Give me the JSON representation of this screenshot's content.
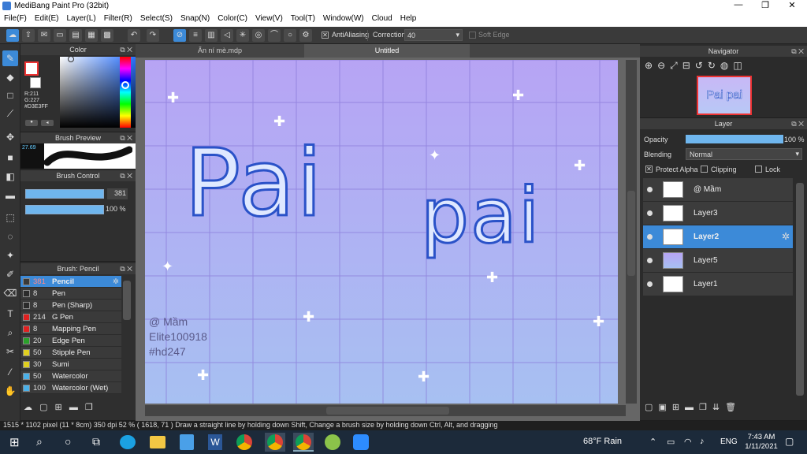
{
  "app": {
    "title": "MediBang Paint Pro (32bit)",
    "min": "—",
    "max": "❐",
    "close": "✕"
  },
  "menu": [
    "File(F)",
    "Edit(E)",
    "Layer(L)",
    "Filter(R)",
    "Select(S)",
    "Snap(N)",
    "Color(C)",
    "View(V)",
    "Tool(T)",
    "Window(W)",
    "Cloud",
    "Help"
  ],
  "toolbar": {
    "antialias": "AntiAliasing",
    "correction_label": "Correction",
    "correction_value": "40",
    "soft_edge": "Soft Edge"
  },
  "color_panel": {
    "title": "Color",
    "r": "R:211",
    "g": "G:227",
    "hex": "#D3E3FF",
    "accent": "#D3E3FF"
  },
  "brush_preview": {
    "title": "Brush Preview",
    "size": "27.69"
  },
  "brush_control": {
    "title": "Brush Control",
    "size": "381",
    "opacity": "100 %"
  },
  "brush_list": {
    "title": "Brush: Pencil",
    "items": [
      {
        "size": "381",
        "name": "Pencil",
        "color": "#3a3a3a"
      },
      {
        "size": "8",
        "name": "Pen",
        "color": "#2b2b2b"
      },
      {
        "size": "8",
        "name": "Pen (Sharp)",
        "color": "#2b2b2b"
      },
      {
        "size": "214",
        "name": "G Pen",
        "color": "#e02020"
      },
      {
        "size": "8",
        "name": "Mapping Pen",
        "color": "#e02020"
      },
      {
        "size": "20",
        "name": "Edge Pen",
        "color": "#2aa02a"
      },
      {
        "size": "50",
        "name": "Stipple Pen",
        "color": "#e0d020"
      },
      {
        "size": "30",
        "name": "Sumi",
        "color": "#e0d020"
      },
      {
        "size": "50",
        "name": "Watercolor",
        "color": "#4ab0e8"
      },
      {
        "size": "100",
        "name": "Watercolor (Wet)",
        "color": "#4ab0e8"
      }
    ]
  },
  "tabs": [
    "Ăn ní mè.mdp",
    "Untitled"
  ],
  "artwork": {
    "big_text_1": "Pai",
    "big_text_2": "pai",
    "sig1": "@ Mầm",
    "sig2": "Elite100918",
    "sig3": "#hd247"
  },
  "navigator": {
    "title": "Navigator",
    "thumb_text": "Pai pai"
  },
  "layer_panel": {
    "title": "Layer",
    "opacity_label": "Opacity",
    "opacity_value": "100 %",
    "blending_label": "Blending",
    "blending_value": "Normal",
    "protect_alpha": "Protect Alpha",
    "clipping": "Clipping",
    "lock": "Lock",
    "layers": [
      {
        "name": "@ Mầm"
      },
      {
        "name": "Layer3"
      },
      {
        "name": "Layer2"
      },
      {
        "name": "Layer5"
      },
      {
        "name": "Layer1"
      }
    ]
  },
  "status": "1515 * 1102 pixel  (11 * 8cm)  350 dpi  52 %  ( 1618, 71 )  Draw a straight line by holding down Shift, Change a brush size by holding down Ctrl, Alt, and dragging",
  "taskbar": {
    "weather": "68°F  Rain",
    "lang": "ENG",
    "time": "7:43 AM",
    "date": "1/11/2021"
  }
}
